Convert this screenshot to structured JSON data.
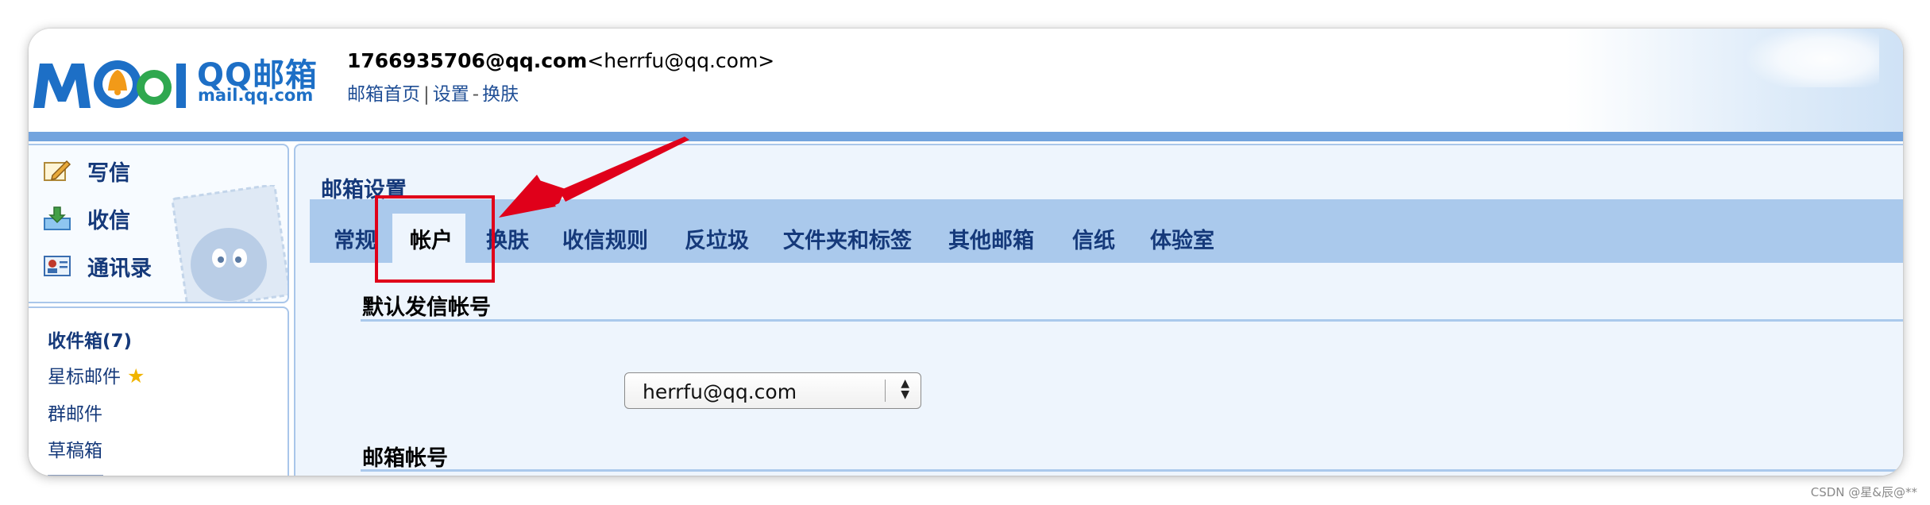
{
  "header": {
    "logo_qq": "QQ邮箱",
    "logo_url": "mail.qq.com",
    "account_email": "1766935706@qq.com",
    "account_alias": "<herrfu@qq.com>",
    "links": {
      "home": "邮箱首页",
      "divider": "|",
      "settings": "设置",
      "dash": "-",
      "skin": "换肤"
    }
  },
  "sidebar": {
    "nav": [
      {
        "label": "写信",
        "icon": "compose-icon"
      },
      {
        "label": "收信",
        "icon": "inbox-download-icon"
      },
      {
        "label": "通讯录",
        "icon": "contacts-card-icon"
      }
    ],
    "folders": [
      {
        "label": "收件箱(7)",
        "bold": true
      },
      {
        "label": "星标邮件",
        "icon": "star-icon"
      },
      {
        "label": "群邮件"
      },
      {
        "label": "草稿箱"
      }
    ]
  },
  "main": {
    "title": "邮箱设置",
    "tabs": [
      {
        "label": "常规"
      },
      {
        "label": "帐户",
        "active": true
      },
      {
        "label": "换肤"
      },
      {
        "label": "收信规则"
      },
      {
        "label": "反垃圾"
      },
      {
        "label": "文件夹和标签"
      },
      {
        "label": "其他邮箱"
      },
      {
        "label": "信纸"
      },
      {
        "label": "体验室"
      }
    ],
    "default_sender_title": "默认发信帐号",
    "default_sender_value": "herrfu@qq.com",
    "mailbox_account_title": "邮箱帐号"
  },
  "annotation": {
    "color": "#e0001a"
  },
  "colors": {
    "accent_blue": "#73a4de",
    "link_blue": "#1f4e95",
    "tab_bar": "#aac9ec"
  },
  "watermark": "CSDN @星&辰@**"
}
